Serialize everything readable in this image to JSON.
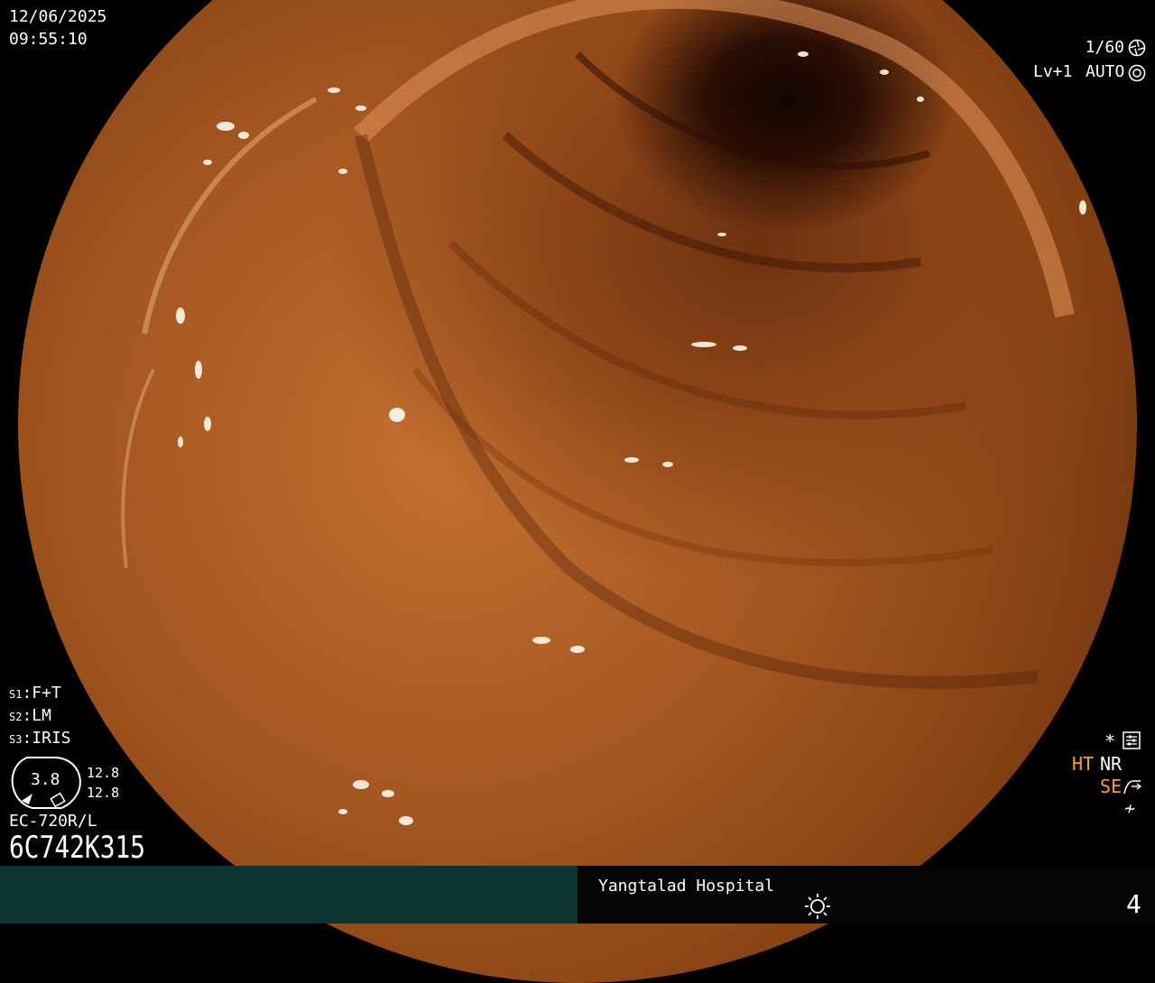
{
  "header": {
    "date": "12/06/2025",
    "time": "09:55:10"
  },
  "top_right": {
    "shutter": "1/60",
    "level": "Lv+1",
    "mode": "AUTO"
  },
  "settings": {
    "s1": {
      "key": "S1",
      "value": "F+T"
    },
    "s2": {
      "key": "S2",
      "value": "LM"
    },
    "s3": {
      "key": "S3",
      "value": "IRIS"
    }
  },
  "gauge": {
    "center_value": "3.8",
    "upper": "12.8",
    "lower": "12.8"
  },
  "scope": {
    "model": "EC-720R/L",
    "serial": "6C742K315"
  },
  "right_indicators": {
    "asterisk": "*",
    "ht": "HT",
    "nr": "NR",
    "se": "SE",
    "extra": "≁"
  },
  "footer": {
    "hospital": "Yangtalad Hospital",
    "page_number": "4"
  },
  "icons": {
    "shutter": "aperture-icon",
    "auto": "iris-auto-icon",
    "settings": "settings-panel-icon",
    "se": "enhance-curve-icon",
    "light": "light-source-icon"
  },
  "colors": {
    "tissue_light": "#c47030",
    "tissue_dark": "#5a2a0a",
    "lumen": "#120602",
    "status_orange": "#f4a326",
    "footer_left_bg": "#0e3533",
    "footer_right_bg": "#050505"
  }
}
